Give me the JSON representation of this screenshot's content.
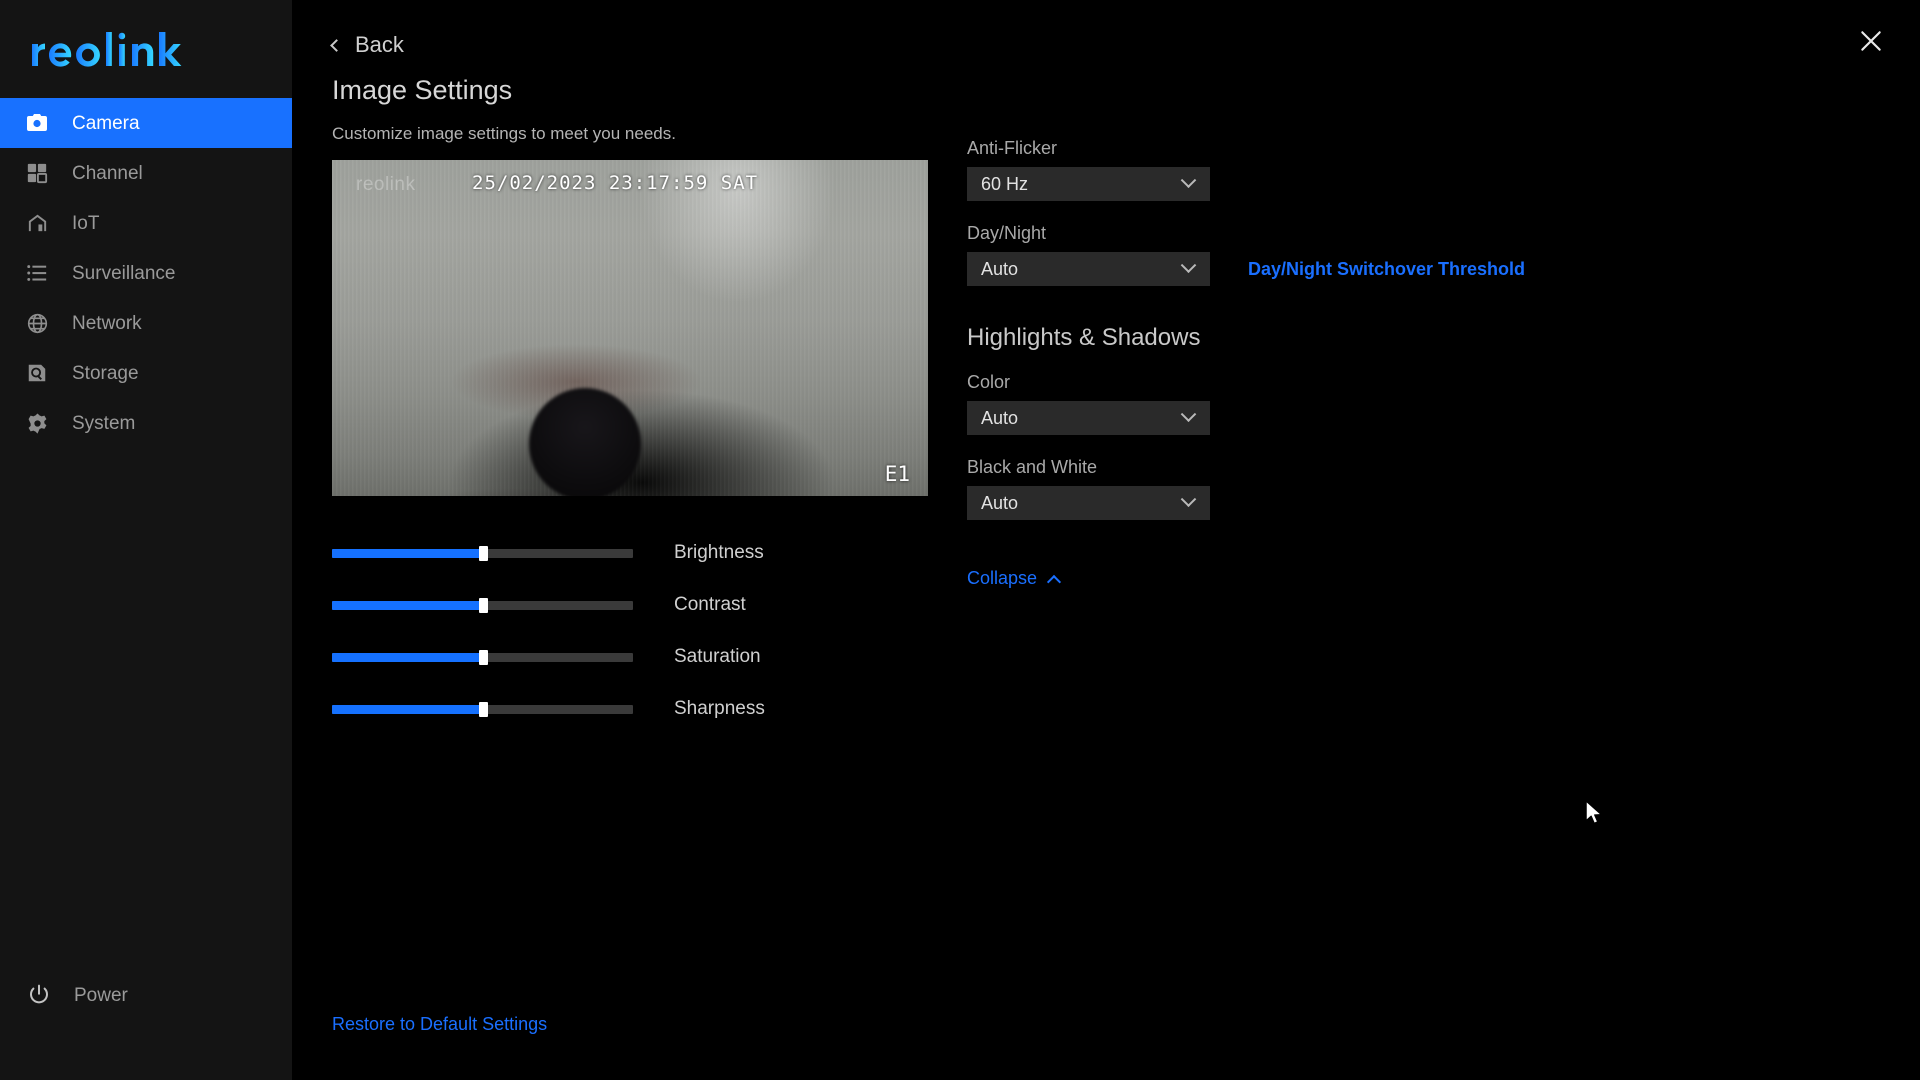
{
  "brand": {
    "name": "reolink",
    "accent": "#1871ff",
    "accent2": "#2fd0ff"
  },
  "sidebar": {
    "items": [
      {
        "label": "Camera",
        "icon": "camera-icon",
        "active": true
      },
      {
        "label": "Channel",
        "icon": "grid-icon",
        "active": false
      },
      {
        "label": "IoT",
        "icon": "home-icon",
        "active": false
      },
      {
        "label": "Surveillance",
        "icon": "list-icon",
        "active": false
      },
      {
        "label": "Network",
        "icon": "globe-icon",
        "active": false
      },
      {
        "label": "Storage",
        "icon": "storage-icon",
        "active": false
      },
      {
        "label": "System",
        "icon": "gear-icon",
        "active": false
      }
    ],
    "power": {
      "label": "Power",
      "icon": "power-icon"
    }
  },
  "header": {
    "back_label": "Back",
    "title": "Image Settings",
    "subtitle": "Customize image settings to meet you needs.",
    "close_icon": "close-icon"
  },
  "preview": {
    "watermark": "reolink",
    "timestamp": "25/02/2023 23:17:59 SAT",
    "channel": "E1"
  },
  "sliders": [
    {
      "label": "Brightness",
      "value": 50
    },
    {
      "label": "Contrast",
      "value": 50
    },
    {
      "label": "Saturation",
      "value": 50
    },
    {
      "label": "Sharpness",
      "value": 50
    }
  ],
  "footer": {
    "restore_label": "Restore to Default Settings"
  },
  "settings": {
    "anti_flicker": {
      "label": "Anti-Flicker",
      "value": "60 Hz"
    },
    "day_night": {
      "label": "Day/Night",
      "value": "Auto",
      "link_label": "Day/Night Switchover Threshold"
    },
    "highlights_shadows": {
      "heading": "Highlights & Shadows",
      "color": {
        "label": "Color",
        "value": "Auto"
      },
      "black_and_white": {
        "label": "Black and White",
        "value": "Auto"
      }
    },
    "collapse_label": "Collapse"
  }
}
